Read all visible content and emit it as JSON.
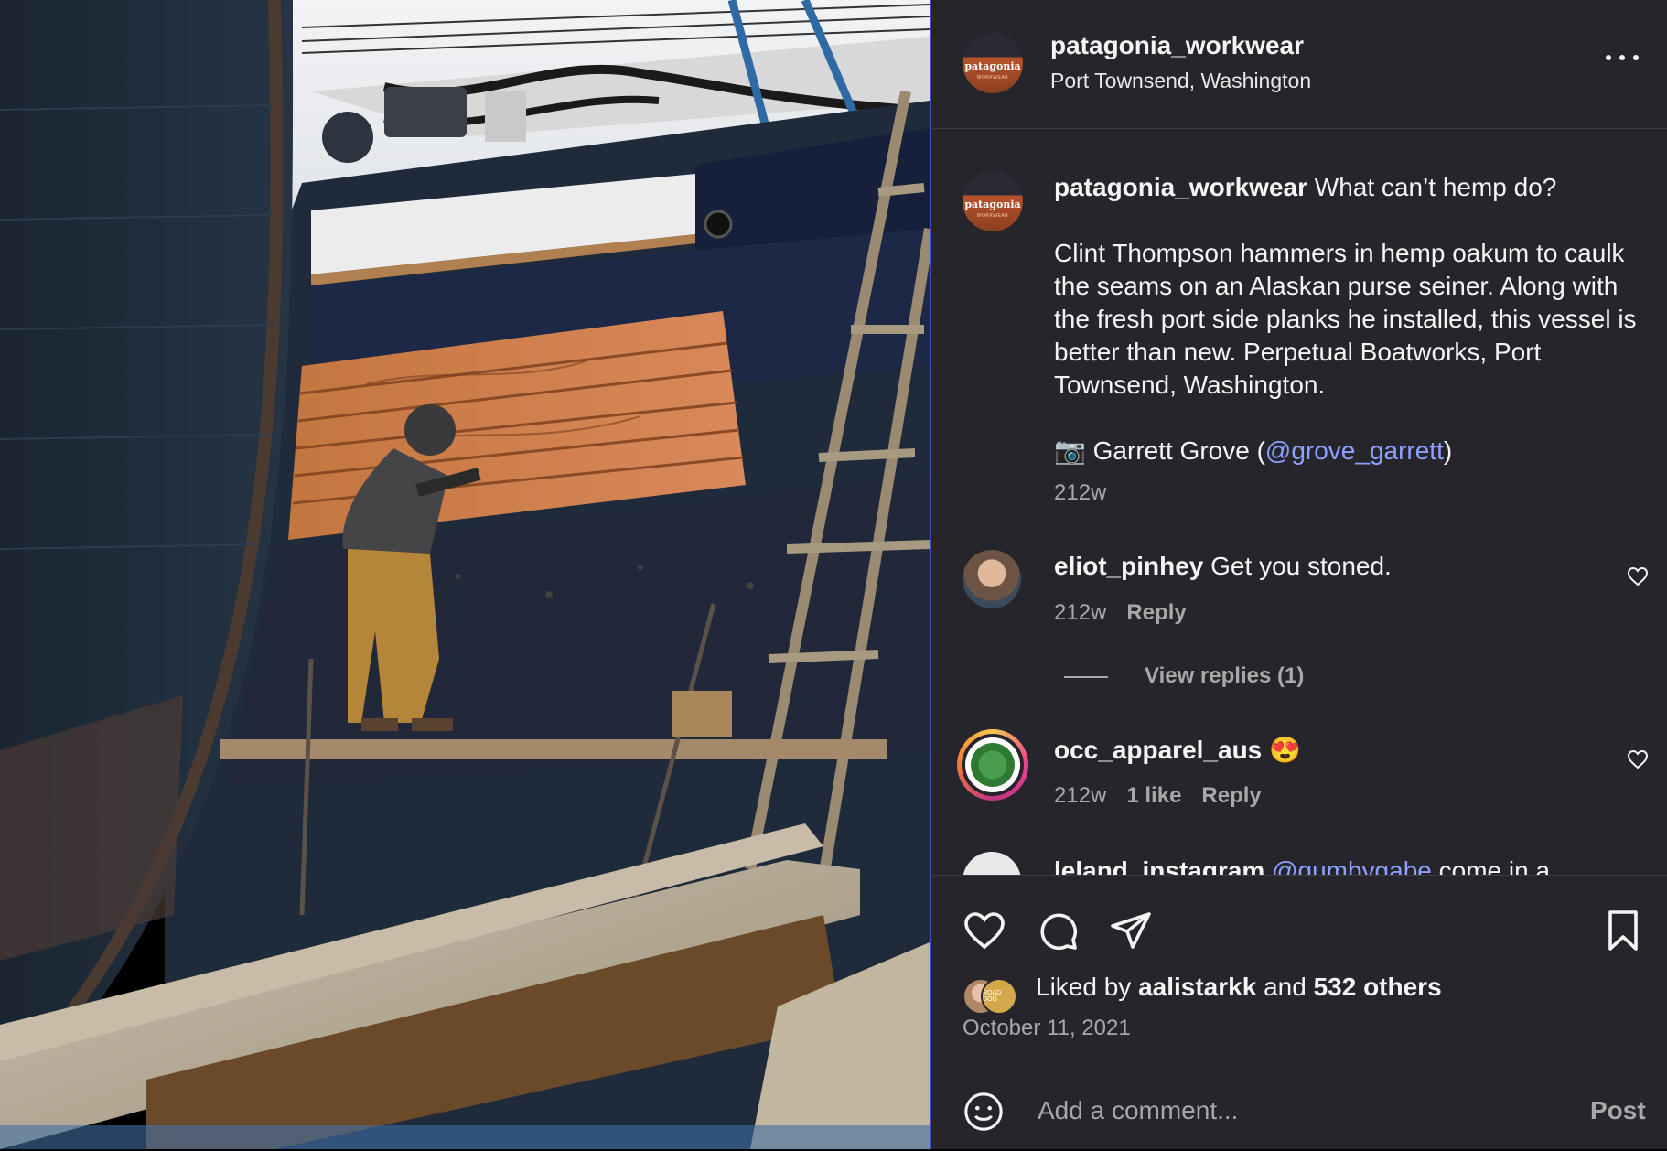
{
  "post": {
    "username": "patagonia_workwear",
    "location": "Port Townsend, Washington",
    "avatar_text": "patagonia",
    "avatar_sub": "WORKWEAR",
    "caption_title": "What can’t hemp do?",
    "caption_body": "Clint Thompson hammers in hemp oakum to caulk the seams on an Alaskan purse seiner. Along with the fresh port side planks he installed, this vessel is better than new. Perpetual Boatworks, Port Townsend, Washington.",
    "credit_prefix": "📷 Garrett Grove (",
    "credit_mention": "@grove_garrett",
    "credit_suffix": ")",
    "caption_time": "212w"
  },
  "comments": [
    {
      "user": "eliot_pinhey",
      "text": "Get you stoned.",
      "time": "212w",
      "reply": "Reply",
      "view_replies": "View replies (1)"
    },
    {
      "user": "occ_apparel_aus",
      "text": "😍",
      "time": "212w",
      "likes": "1 like",
      "reply": "Reply"
    },
    {
      "user": "leland_instagram",
      "mention": "@gumbygabe",
      "text": "come in a"
    }
  ],
  "footer": {
    "liked_prefix": "Liked by",
    "liked_user": "aalistarkk",
    "liked_and": "and",
    "liked_others": "532 others",
    "date": "October 11, 2021",
    "liker_badge": "ROAD DOG",
    "comment_placeholder": "Add a comment...",
    "post_label": "Post"
  }
}
